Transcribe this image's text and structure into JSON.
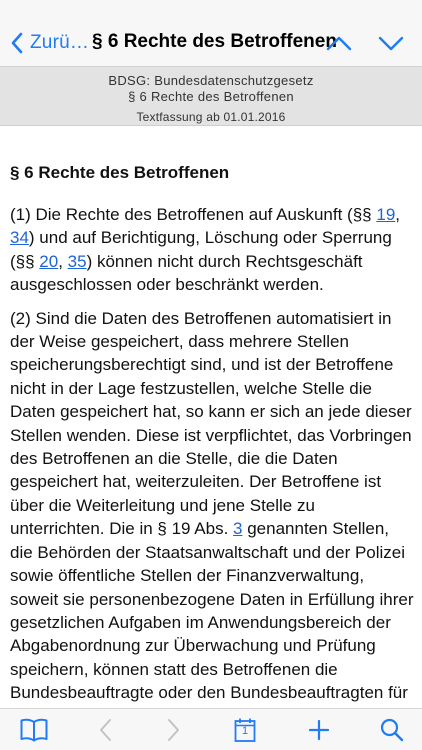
{
  "navbar": {
    "back_label": "Zurü…",
    "title": "§ 6 Rechte des Betroffenen"
  },
  "subheader": {
    "law_name": "BDSG: Bundesdatenschutzgesetz",
    "section": "§ 6 Rechte des Betroffenen",
    "version": "Textfassung ab 01.01.2016"
  },
  "content": {
    "heading": "§ 6 Rechte des Betroffenen",
    "p1": {
      "t1": "(1) Die Rechte des Betroffenen auf Auskunft (§§ ",
      "l1": "19",
      "t2": ", ",
      "l2": "34",
      "t3": ") und auf Berichtigung, Löschung oder Sperrung (§§ ",
      "l3": "20",
      "t4": ", ",
      "l4": "35",
      "t5": ") können nicht durch Rechtsgeschäft ausgeschlossen oder beschränkt werden."
    },
    "p2": {
      "t1": "(2) Sind die Daten des Betroffenen automatisiert in der Weise gespeichert, dass mehrere Stellen speicherungsberechtigt sind, und ist der Betroffene nicht in der Lage festzustellen, welche Stelle die Daten gespeichert hat, so kann er sich an jede dieser Stellen wenden. Diese ist verpflichtet, das Vorbringen des Betroffenen an die Stelle, die die Daten gespeichert hat, weiterzuleiten. Der Betroffene ist über die Weiterleitung und jene Stelle zu unterrichten. Die in § 19 Abs. ",
      "l1": "3",
      "t2": " genannten Stellen, die Behörden der Staatsanwaltschaft und der Polizei sowie öffentliche Stellen der Finanzverwaltung, soweit sie personenbezogene Daten in Erfüllung ihrer gesetzlichen Aufgaben im Anwendungsbereich der Abgabenordnung zur Überwachung und Prüfung speichern, können statt des Betroffenen die Bundesbeauftragte oder den Bundesbeauftragten für den Datenschutz und die Informationsfreiheit unterrichten."
    }
  },
  "toolbar": {
    "calendar_day": "1"
  },
  "colors": {
    "accent": "#1f7cf5",
    "link": "#1f63d8",
    "toolbar_bg": "#f7f7f7",
    "subheader_bg": "#e3e3e3"
  },
  "icons": [
    "chevron-left-icon",
    "chevron-up-icon",
    "chevron-down-icon",
    "book-icon",
    "arrow-left-icon",
    "arrow-right-icon",
    "calendar-icon",
    "plus-icon",
    "search-icon"
  ]
}
